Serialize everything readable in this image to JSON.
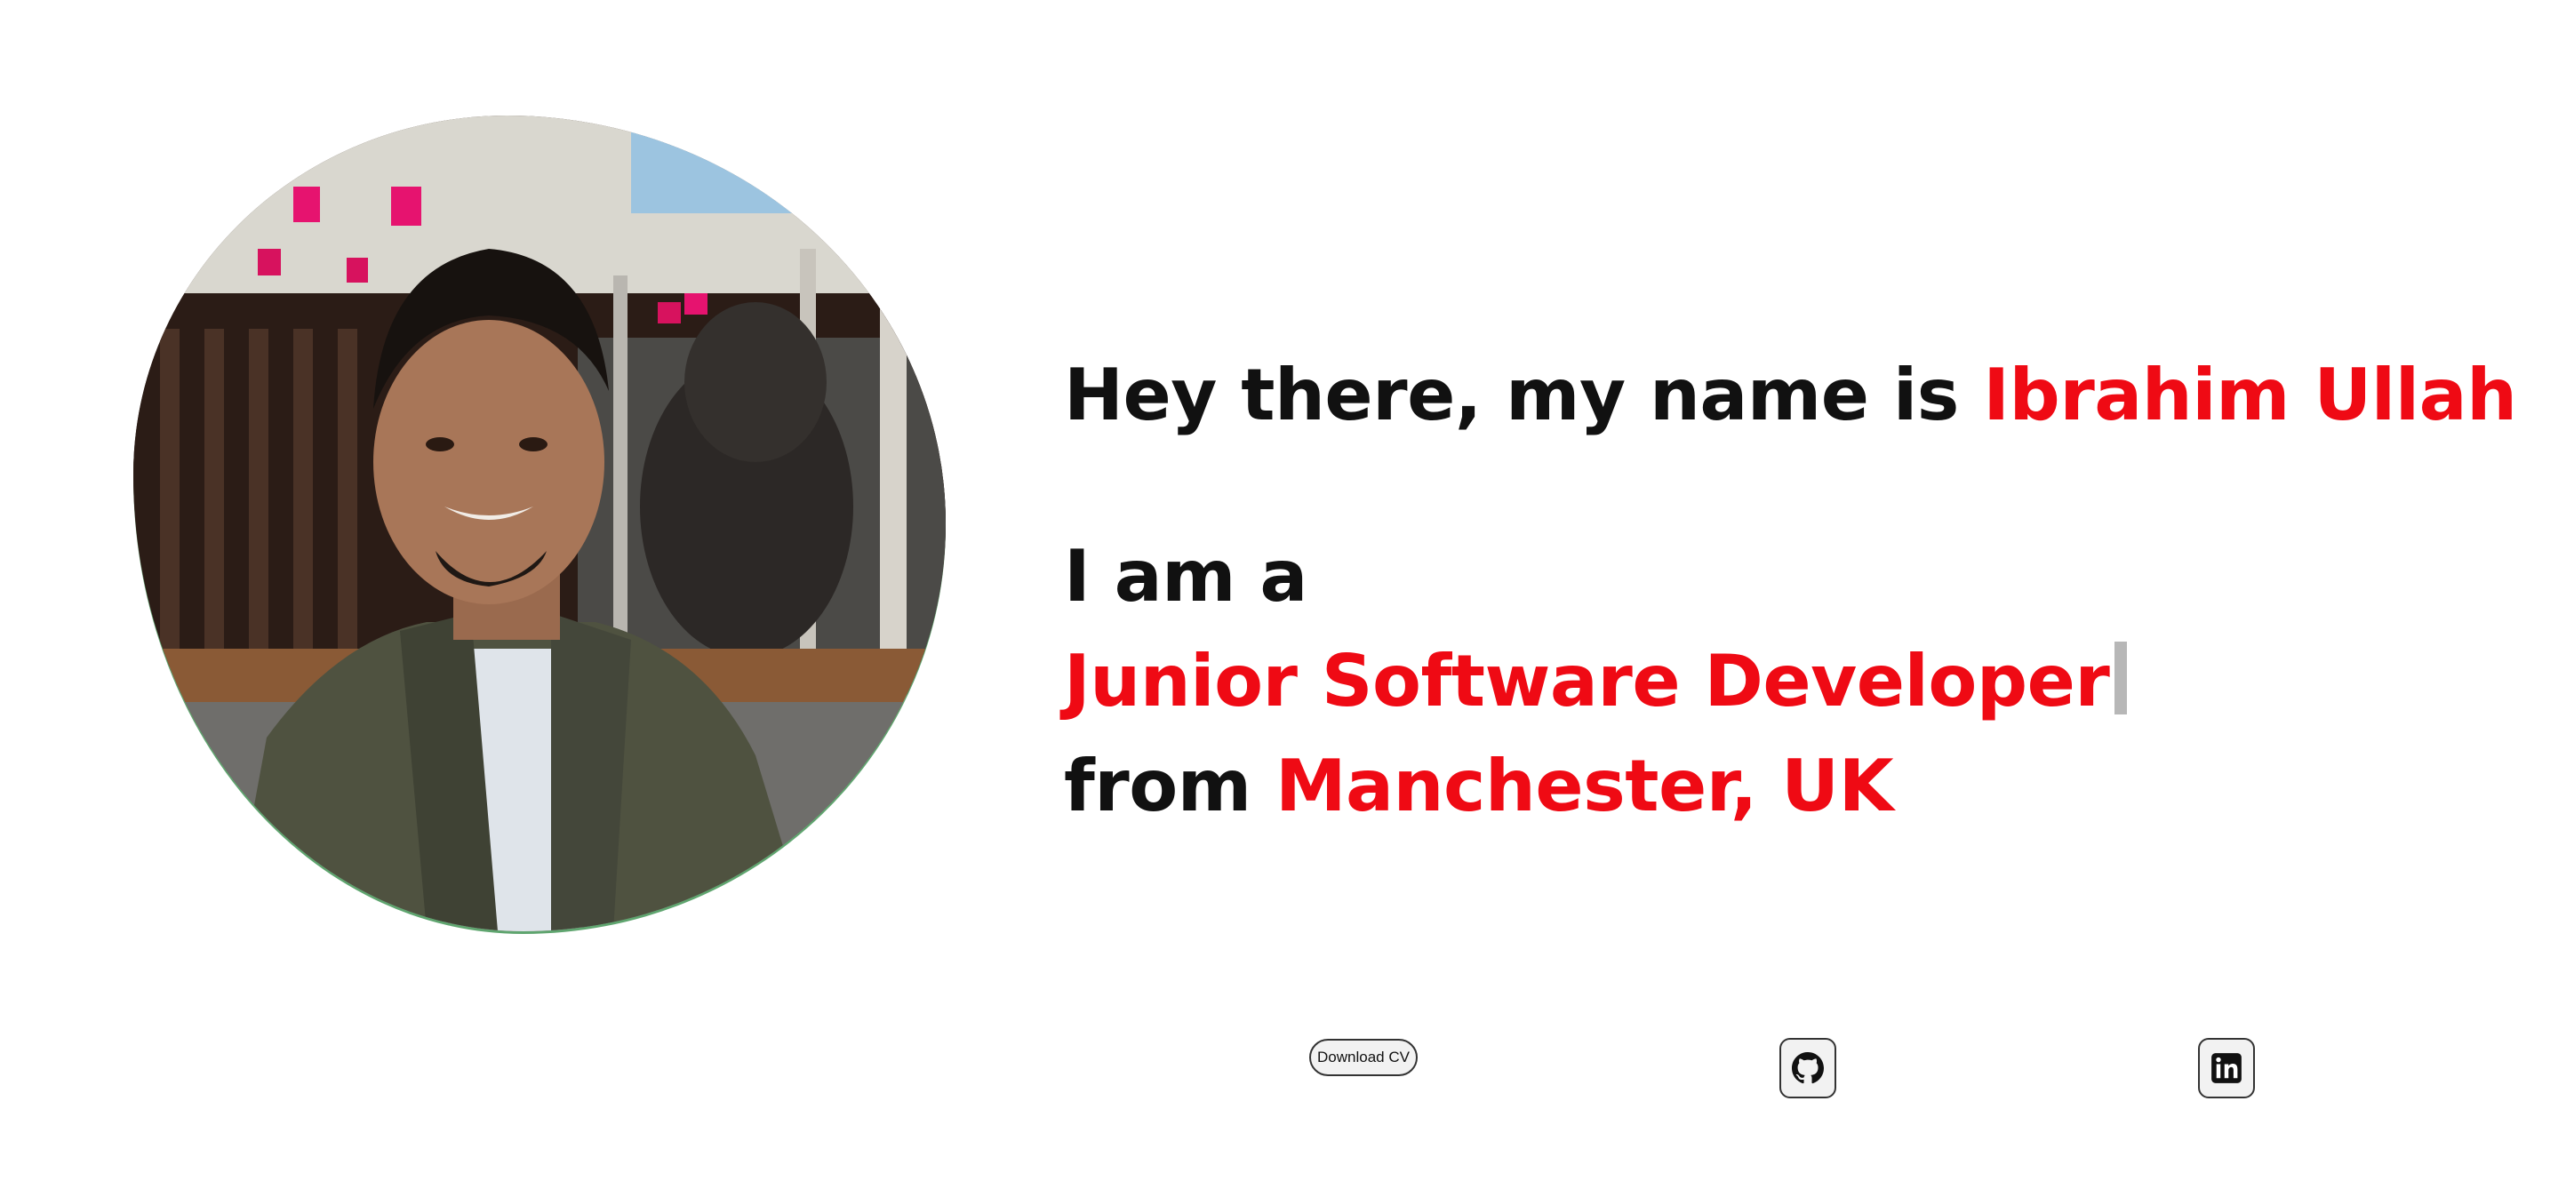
{
  "hero": {
    "greeting_prefix": "Hey there, my name is",
    "name": "Ibrahim Ullah",
    "role_prefix": "I am a",
    "role": "Junior Software Developer",
    "location_prefix": "from",
    "location": "Manchester, UK"
  },
  "actions": {
    "download_cv_label": "Download CV",
    "github_icon": "github-icon",
    "linkedin_icon": "linkedin-icon"
  },
  "colors": {
    "accent": "#ef0a14",
    "text": "#111111",
    "caret": "#b7b7b7"
  }
}
